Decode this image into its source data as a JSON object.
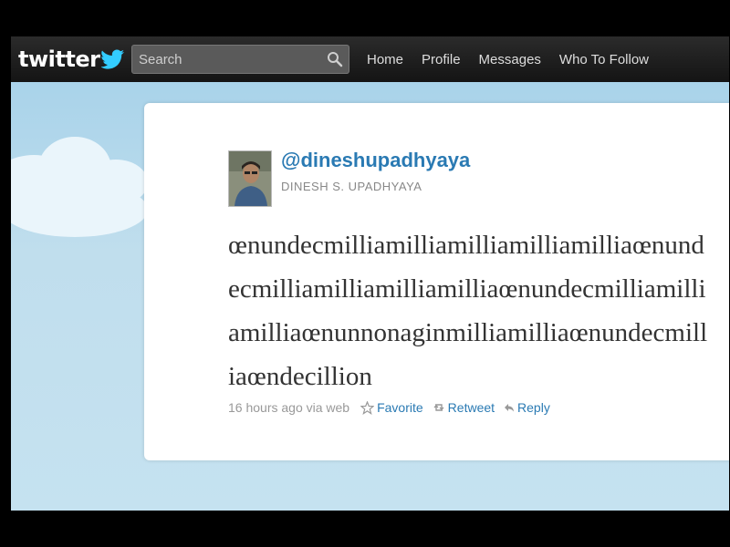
{
  "topbar": {
    "logo_text": "twitter",
    "search": {
      "placeholder": "Search",
      "icon": "search-icon"
    },
    "nav": [
      "Home",
      "Profile",
      "Messages",
      "Who To Follow"
    ]
  },
  "tweet": {
    "handle": "@dineshupadhyaya",
    "full_name": "DINESH S. UPADHYAYA",
    "text": "œnundecmilliamilliamilliamilliamilliaœnundecmilliamilliamilliamilliaœnundecmilliamilliamilliaœnunnonaginmilliamilliaœnundecmilliaœndecillion",
    "timestamp": "16 hours ago via web",
    "actions": {
      "favorite": "Favorite",
      "retweet": "Retweet",
      "reply": "Reply"
    }
  },
  "colors": {
    "link": "#2a7ab3",
    "topbar": "#1b1b1b",
    "background": "#c0deed",
    "logo_bird": "#33ccff"
  }
}
